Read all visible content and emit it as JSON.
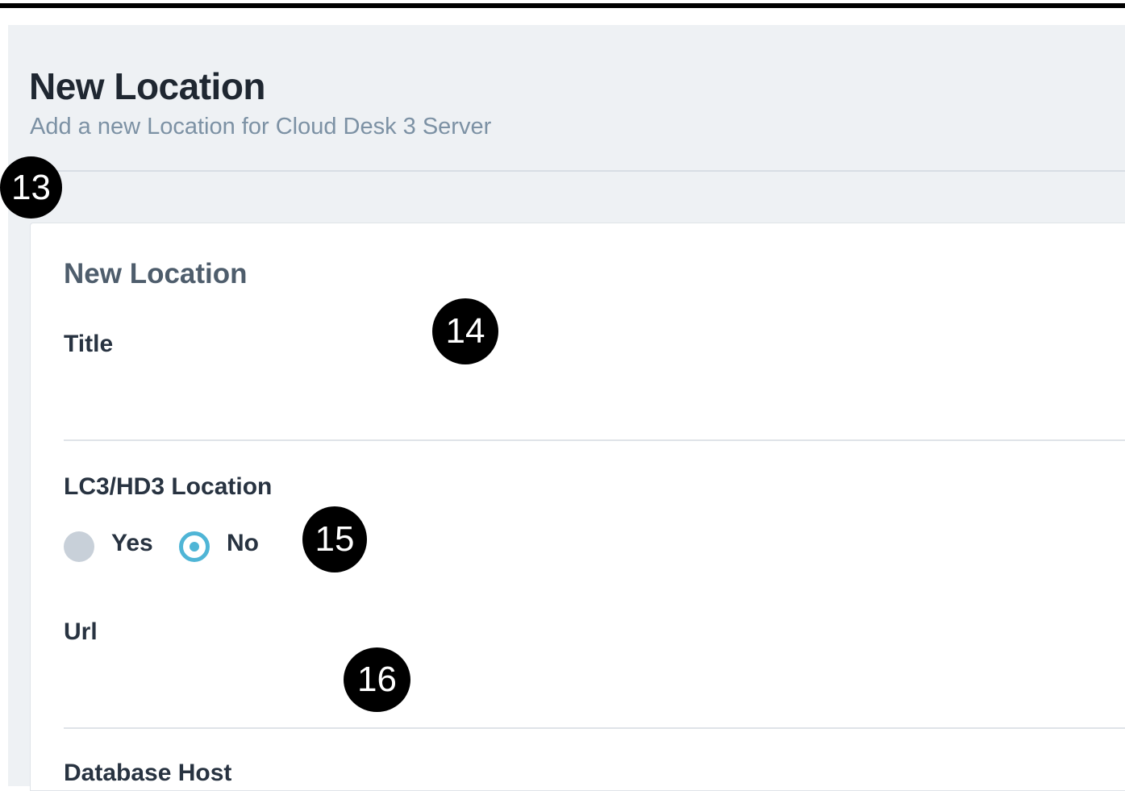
{
  "header": {
    "title": "New Location",
    "subtitle": "Add a new Location for Cloud Desk 3 Server"
  },
  "form": {
    "card_title": "New Location",
    "title_field": {
      "label": "Title",
      "value": "",
      "placeholder": ""
    },
    "location_field": {
      "label": "LC3/HD3 Location",
      "options": [
        {
          "label": "Yes",
          "selected": false
        },
        {
          "label": "No",
          "selected": true
        }
      ]
    },
    "url_field": {
      "label": "Url",
      "value": "",
      "placeholder": ""
    },
    "database_host_field": {
      "label": "Database Host"
    }
  },
  "annotations": [
    "13",
    "14",
    "15",
    "16"
  ],
  "colors": {
    "page_background": "#eef1f4",
    "accent": "#4fb5d6",
    "subtitle": "#7c91a4",
    "card_title": "#4e5d6c"
  }
}
